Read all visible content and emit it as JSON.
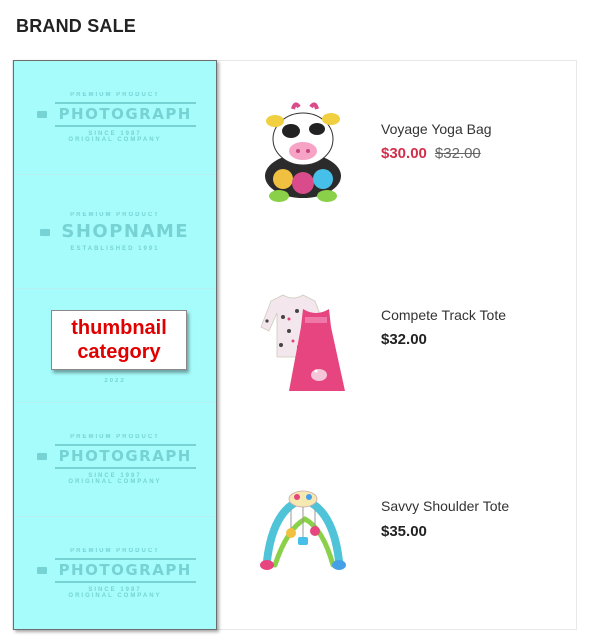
{
  "section": {
    "title": "BRAND SALE"
  },
  "brands": [
    {
      "top": "PREMIUM PRODUCT",
      "main": "PHOTOGRAPH",
      "sub": "SINCE 1987",
      "bottom": "ORIGINAL COMPANY"
    },
    {
      "top": "PREMIUM PRODUCT",
      "main": "SHOPNAME",
      "sub": "",
      "bottom": "ESTABLISHED 1991"
    },
    {
      "top": "",
      "main": "",
      "sub": "",
      "bottom": "2022"
    },
    {
      "top": "PREMIUM PRODUCT",
      "main": "PHOTOGRAPH",
      "sub": "SINCE 1987",
      "bottom": "ORIGINAL COMPANY"
    },
    {
      "top": "PREMIUM PRODUCT",
      "main": "PHOTOGRAPH",
      "sub": "SINCE 1987",
      "bottom": "ORIGINAL COMPANY"
    }
  ],
  "thumbnail_label": {
    "line1": "thumbnail",
    "line2": "category"
  },
  "products": [
    {
      "name": "Voyage Yoga Bag",
      "price": "$30.00",
      "old_price": "$32.00",
      "image": "plush-cow-toy"
    },
    {
      "name": "Compete Track Tote",
      "price": "$32.00",
      "old_price": "",
      "image": "baby-dress-set"
    },
    {
      "name": "Savvy Shoulder Tote",
      "price": "$35.00",
      "old_price": "",
      "image": "baby-play-gym"
    }
  ],
  "colors": {
    "sale_price": "#d0304a",
    "brand_column_bg": "#a6fbfb",
    "label_text": "#e00000"
  }
}
